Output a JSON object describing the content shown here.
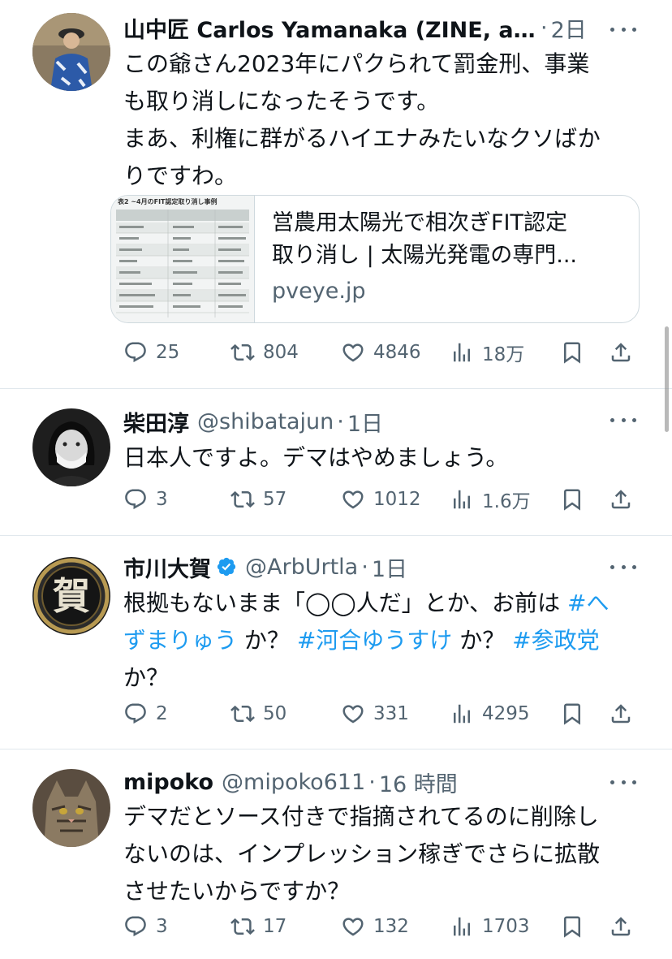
{
  "tweets": [
    {
      "name": "山中匠 Carlos Yamanaka (ZINE, a...",
      "handle": "",
      "dot": "·",
      "time": "2日",
      "verified": false,
      "body_lines": [
        "この爺さん2023年にパクられて罰金刑、事業",
        "も取り消しになったそうです。",
        "まあ、利権に群がるハイエナみたいなクソばか",
        "りですわ。"
      ],
      "card": {
        "title_line1": "営農用太陽光で相次ぎFIT認定",
        "title_line2": "取り消し | 太陽光発電の専門...",
        "domain": "pveye.jp",
        "thumb_header": "表2 ~4月のFIT認定取り消し事例"
      },
      "replies": "25",
      "retweets": "804",
      "likes": "4846",
      "views": "18万"
    },
    {
      "name": "柴田淳",
      "handle": "@shibatajun",
      "dot": "·",
      "time": "1日",
      "verified": false,
      "body_lines": [
        "日本人ですよ。デマはやめましょう。"
      ],
      "replies": "3",
      "retweets": "57",
      "likes": "1012",
      "views": "1.6万"
    },
    {
      "name": "市川大賀",
      "handle": "@ArbUrtla",
      "dot": "·",
      "time": "1日",
      "verified": true,
      "body": {
        "l1a": "根拠もないまま「◯◯人だ」とか、お前は ",
        "l1tag": "#へ",
        "l2tag1": "ずまりゅう",
        "l2a": " か？ ",
        "l2tag2": "#河合ゆうすけ",
        "l2b": " か？ ",
        "l2tag3": "#参政党",
        "l3": "か？"
      },
      "avatar_glyph": "賀",
      "replies": "2",
      "retweets": "50",
      "likes": "331",
      "views": "4295"
    },
    {
      "name": "mipoko",
      "handle": "@mipoko611",
      "dot": "·",
      "time": "16 時間",
      "verified": false,
      "body_lines": [
        "デマだとソース付きで指摘されてるのに削除し",
        "ないのは、インプレッション稼ぎでさらに拡散",
        "させたいからですか？"
      ],
      "replies": "3",
      "retweets": "17",
      "likes": "132",
      "views": "1703"
    }
  ],
  "colors": {
    "text": "#0f1419",
    "secondary": "#536471",
    "link": "#1d9bf0",
    "verified": "#1d9bf0"
  },
  "icons": [
    "reply-icon",
    "retweet-icon",
    "like-icon",
    "views-icon",
    "bookmark-icon",
    "share-icon",
    "more-icon",
    "verified-icon"
  ]
}
